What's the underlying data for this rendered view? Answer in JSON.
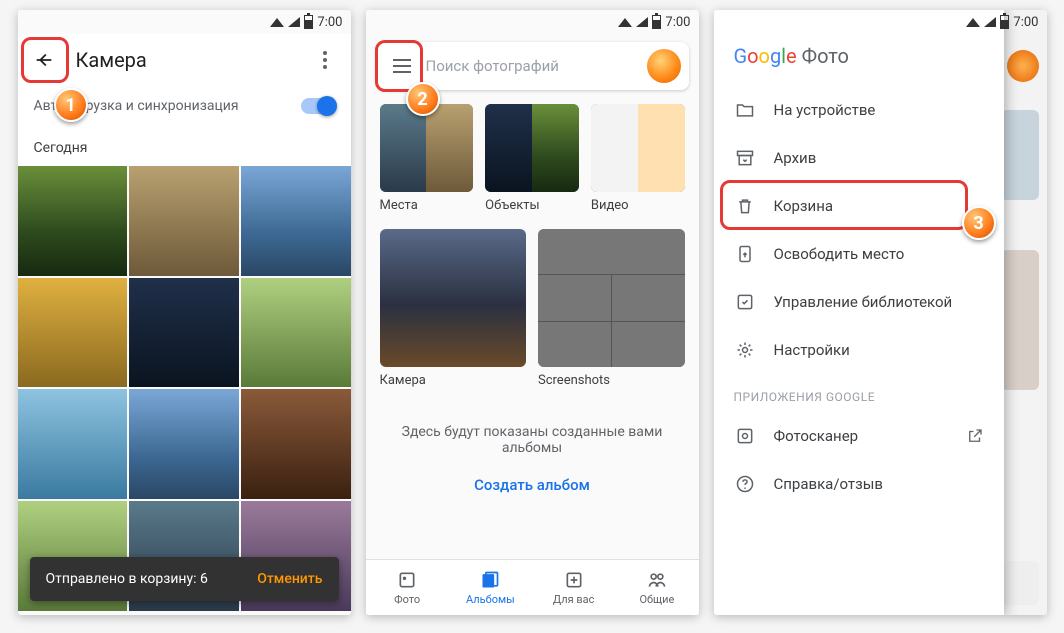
{
  "statusbar": {
    "time": "7:00"
  },
  "annotations": {
    "step1": "1",
    "step2": "2",
    "step3": "3"
  },
  "screen1": {
    "title": "Камера",
    "sync_label": "Автозагрузка и синхронизация",
    "section": "Сегодня",
    "toast_text": "Отправлено в корзину: 6",
    "toast_action": "Отменить"
  },
  "screen2": {
    "search_placeholder": "Поиск фотографий",
    "categories": [
      {
        "label": "Места"
      },
      {
        "label": "Объекты"
      },
      {
        "label": "Видео"
      }
    ],
    "albums": [
      {
        "label": "Камера"
      },
      {
        "label": "Screenshots"
      }
    ],
    "hint": "Здесь будут показаны созданные вами альбомы",
    "create_link": "Создать альбом",
    "nav": [
      {
        "label": "Фото"
      },
      {
        "label": "Альбомы"
      },
      {
        "label": "Для вас"
      },
      {
        "label": "Общие"
      }
    ]
  },
  "screen3": {
    "logo_suffix": "Фото",
    "items": [
      {
        "label": "На устройстве"
      },
      {
        "label": "Архив"
      },
      {
        "label": "Корзина"
      },
      {
        "label": "Освободить место"
      },
      {
        "label": "Управление библиотекой"
      },
      {
        "label": "Настройки"
      }
    ],
    "apps_header": "ПРИЛОЖЕНИЯ GOOGLE",
    "photoscan": "Фотосканер",
    "help": "Справка/отзыв"
  }
}
